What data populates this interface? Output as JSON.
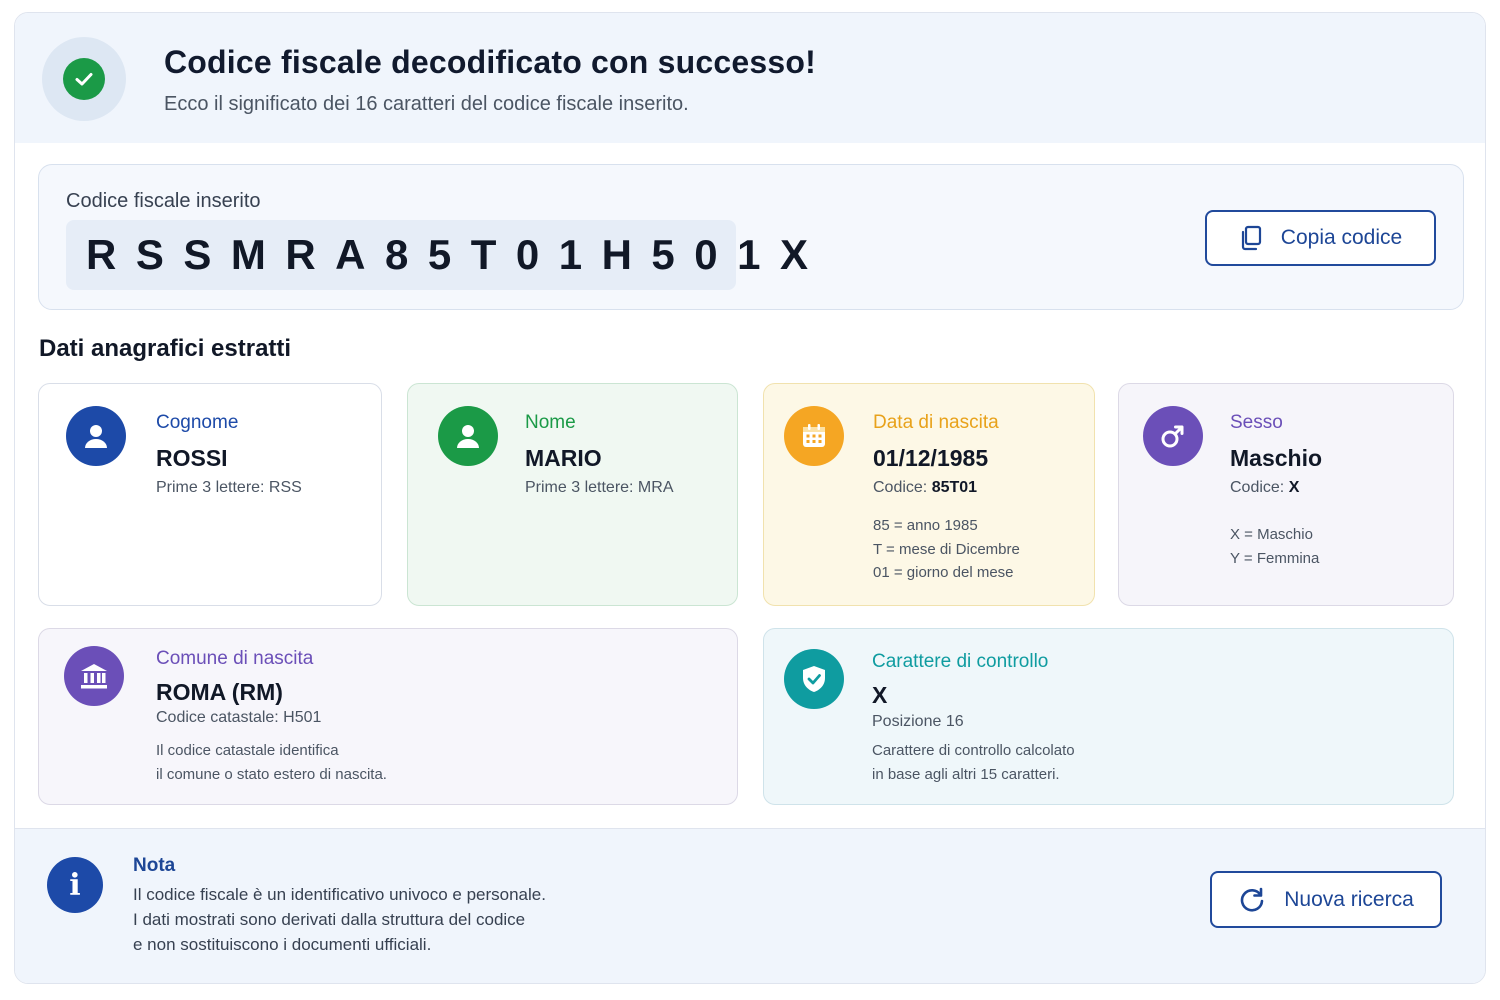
{
  "header": {
    "title": "Codice fiscale decodificato con successo!",
    "subtitle": "Ecco il significato dei 16 caratteri del codice fiscale inserito."
  },
  "code": {
    "label": "Codice fiscale inserito",
    "value": "RSSMRA85T01H501X",
    "copy_label": "Copia codice"
  },
  "section_title": "Dati anagrafici estratti",
  "cards": {
    "cognome": {
      "label": "Cognome",
      "value": "ROSSI",
      "sub": "Prime 3 lettere: RSS",
      "color": "#1d4aa8"
    },
    "nome": {
      "label": "Nome",
      "value": "MARIO",
      "sub": "Prime 3 lettere: MRA",
      "color": "#1b9a47"
    },
    "data": {
      "label": "Data di nascita",
      "value": "01/12/1985",
      "sub_prefix": "Codice: ",
      "sub_code": "85T01",
      "lines": [
        "85 = anno 1985",
        "T = mese di Dicembre",
        "01 = giorno del mese"
      ],
      "color": "#f5a623"
    },
    "sesso": {
      "label": "Sesso",
      "value": "Maschio",
      "sub_prefix": "Codice: ",
      "sub_code": "X",
      "lines": [
        "X = Maschio",
        "Y = Femmina"
      ],
      "color": "#6b4fb8"
    },
    "comune": {
      "label": "Comune di nascita",
      "value": "ROMA (RM)",
      "sub": "Codice catastale: H501",
      "lines": [
        "Il codice catastale identifica",
        "il comune o stato estero di nascita."
      ],
      "color": "#6b4fb8"
    },
    "controllo": {
      "label": "Carattere di controllo",
      "value": "X",
      "sub": "Posizione 16",
      "lines": [
        "Carattere di controllo calcolato",
        "in base agli altri 15 caratteri."
      ],
      "color": "#0f9ca0"
    }
  },
  "footer": {
    "title": "Nota",
    "lines": [
      "Il codice fiscale è un identificativo univoco e personale.",
      "I dati mostrati sono derivati dalla struttura del codice",
      "e non sostituiscono i documenti ufficiali."
    ],
    "button_label": "Nuova ricerca"
  }
}
